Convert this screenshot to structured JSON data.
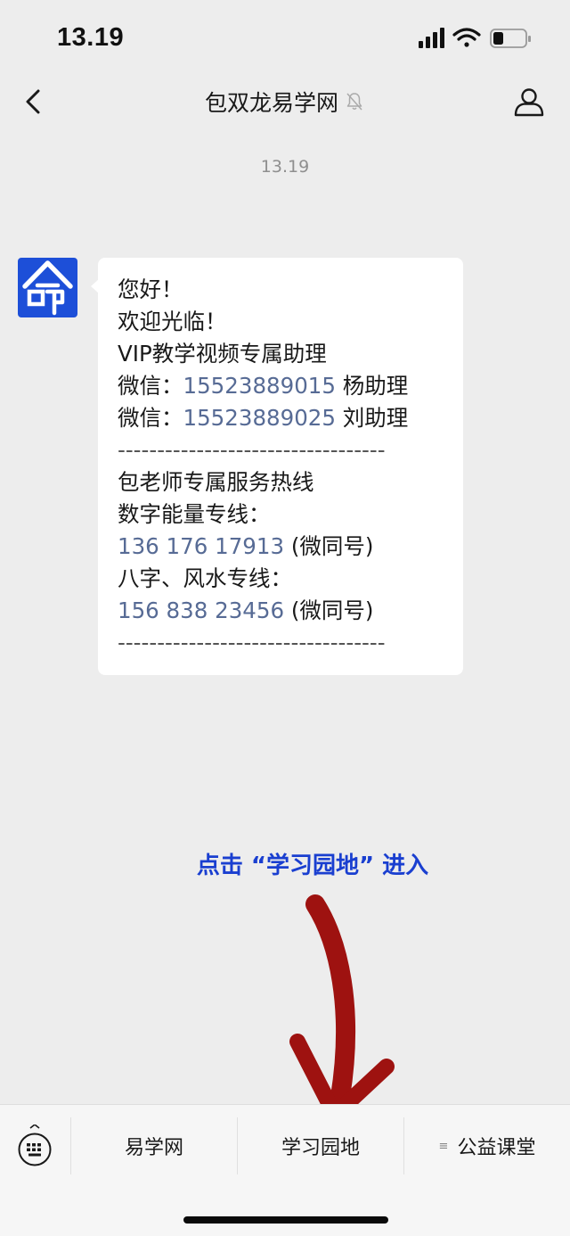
{
  "status_bar": {
    "time": "13.19",
    "icons": [
      "signal-icon",
      "wifi-icon",
      "battery-icon"
    ]
  },
  "nav": {
    "title": "包双龙易学网",
    "icons": [
      "back-icon",
      "mute-bell-icon",
      "profile-icon"
    ]
  },
  "chat": {
    "timestamp": "13.19",
    "avatar_char": "命",
    "avatar_color": "#1d4fd8",
    "lines": {
      "l1": "您好！",
      "l2": "欢迎光临！",
      "l3": "VIP教学视频专属助理",
      "l4_prefix": "微信：",
      "l4_phone": "15523889015",
      "l4_suffix": " 杨助理",
      "l5_prefix": "微信：",
      "l5_phone": "15523889025",
      "l5_suffix": " 刘助理",
      "divider": "----------------------------------",
      "l7": "包老师专属服务热线",
      "l8": "数字能量专线：",
      "l9_phone": "136 176  17913",
      "l9_suffix": " (微同号)",
      "l10": "八字、风水专线：",
      "l11_phone": "156 838 23456",
      "l11_suffix": " (微同号)"
    },
    "link_color": "#576b95"
  },
  "annotation": {
    "text": "点击 “学习园地” 进入",
    "color": "#1a3fd0"
  },
  "bottom_menu": {
    "items": [
      {
        "label": "易学网"
      },
      {
        "label": "学习园地"
      },
      {
        "label": "公益课堂",
        "glyph": "≡"
      }
    ]
  }
}
